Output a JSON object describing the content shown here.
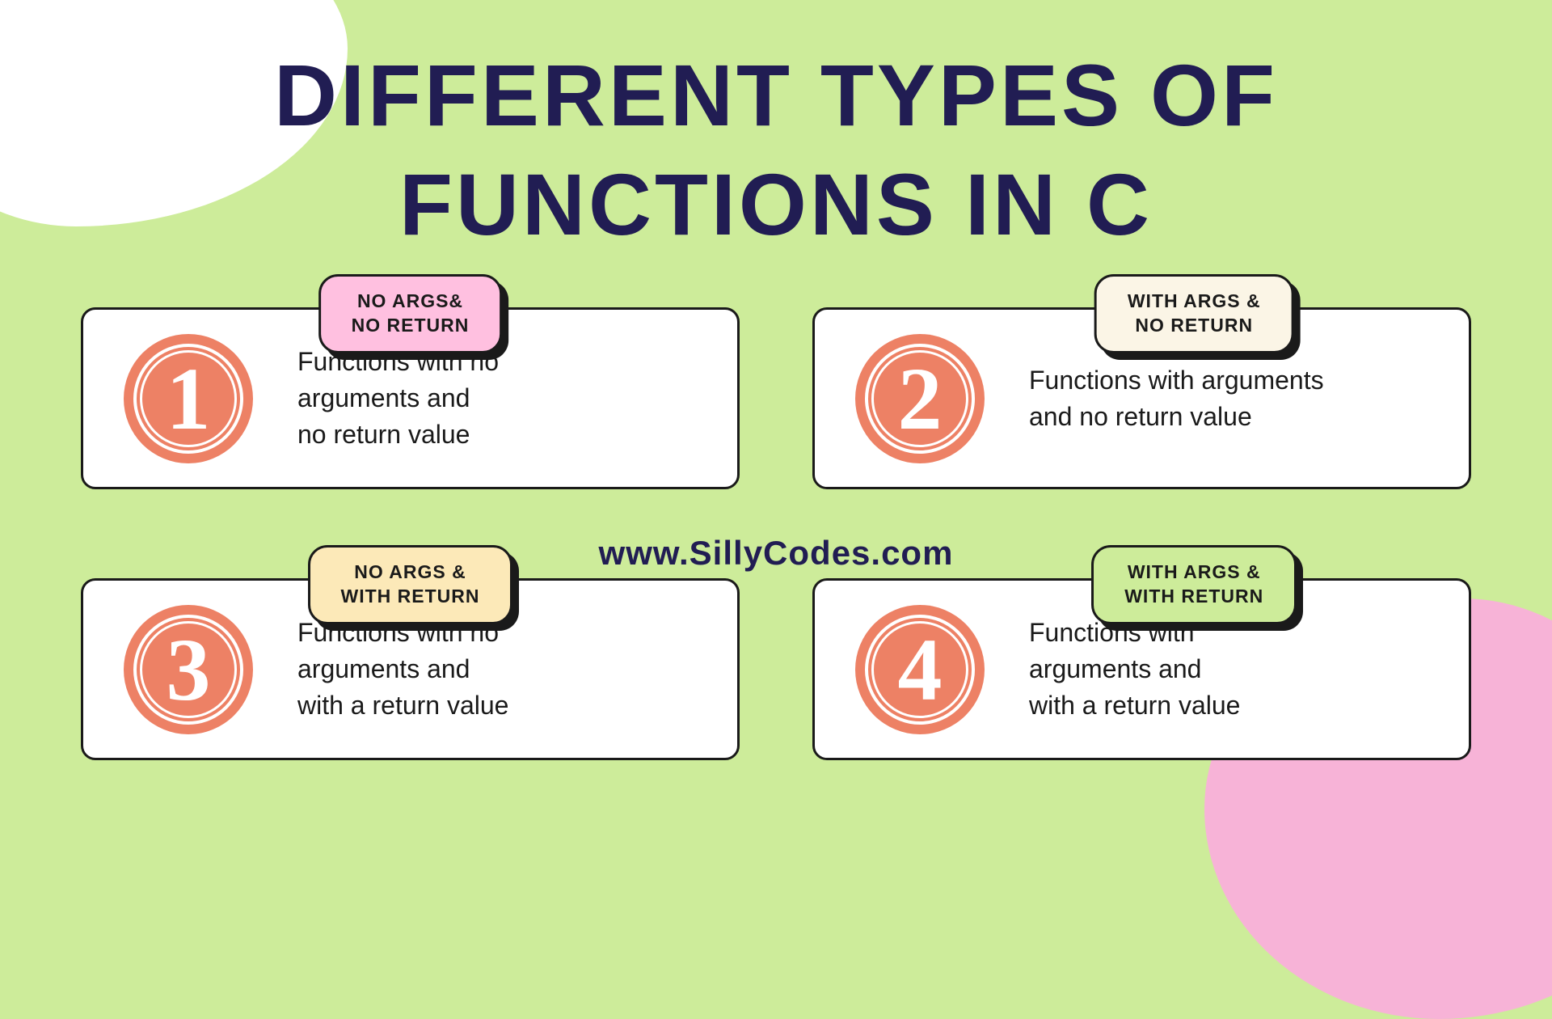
{
  "title": "DIFFERENT TYPES OF\nFUNCTIONS IN C",
  "url": "www.SillyCodes.com",
  "cards": [
    {
      "number": "1",
      "badge": "NO ARGS&\nNO RETURN",
      "badge_color": "pink",
      "desc": "Functions with no\narguments and\nno return value"
    },
    {
      "number": "2",
      "badge": "WITH ARGS &\nNO RETURN",
      "badge_color": "cream2",
      "desc": "Functions with arguments\nand no return value"
    },
    {
      "number": "3",
      "badge": "NO ARGS &\nWITH RETURN",
      "badge_color": "yellow",
      "desc": "Functions with no\narguments and\nwith a return value"
    },
    {
      "number": "4",
      "badge": "WITH ARGS &\nWITH RETURN",
      "badge_color": "green",
      "desc": "Functions with\narguments and\nwith a return value"
    }
  ]
}
